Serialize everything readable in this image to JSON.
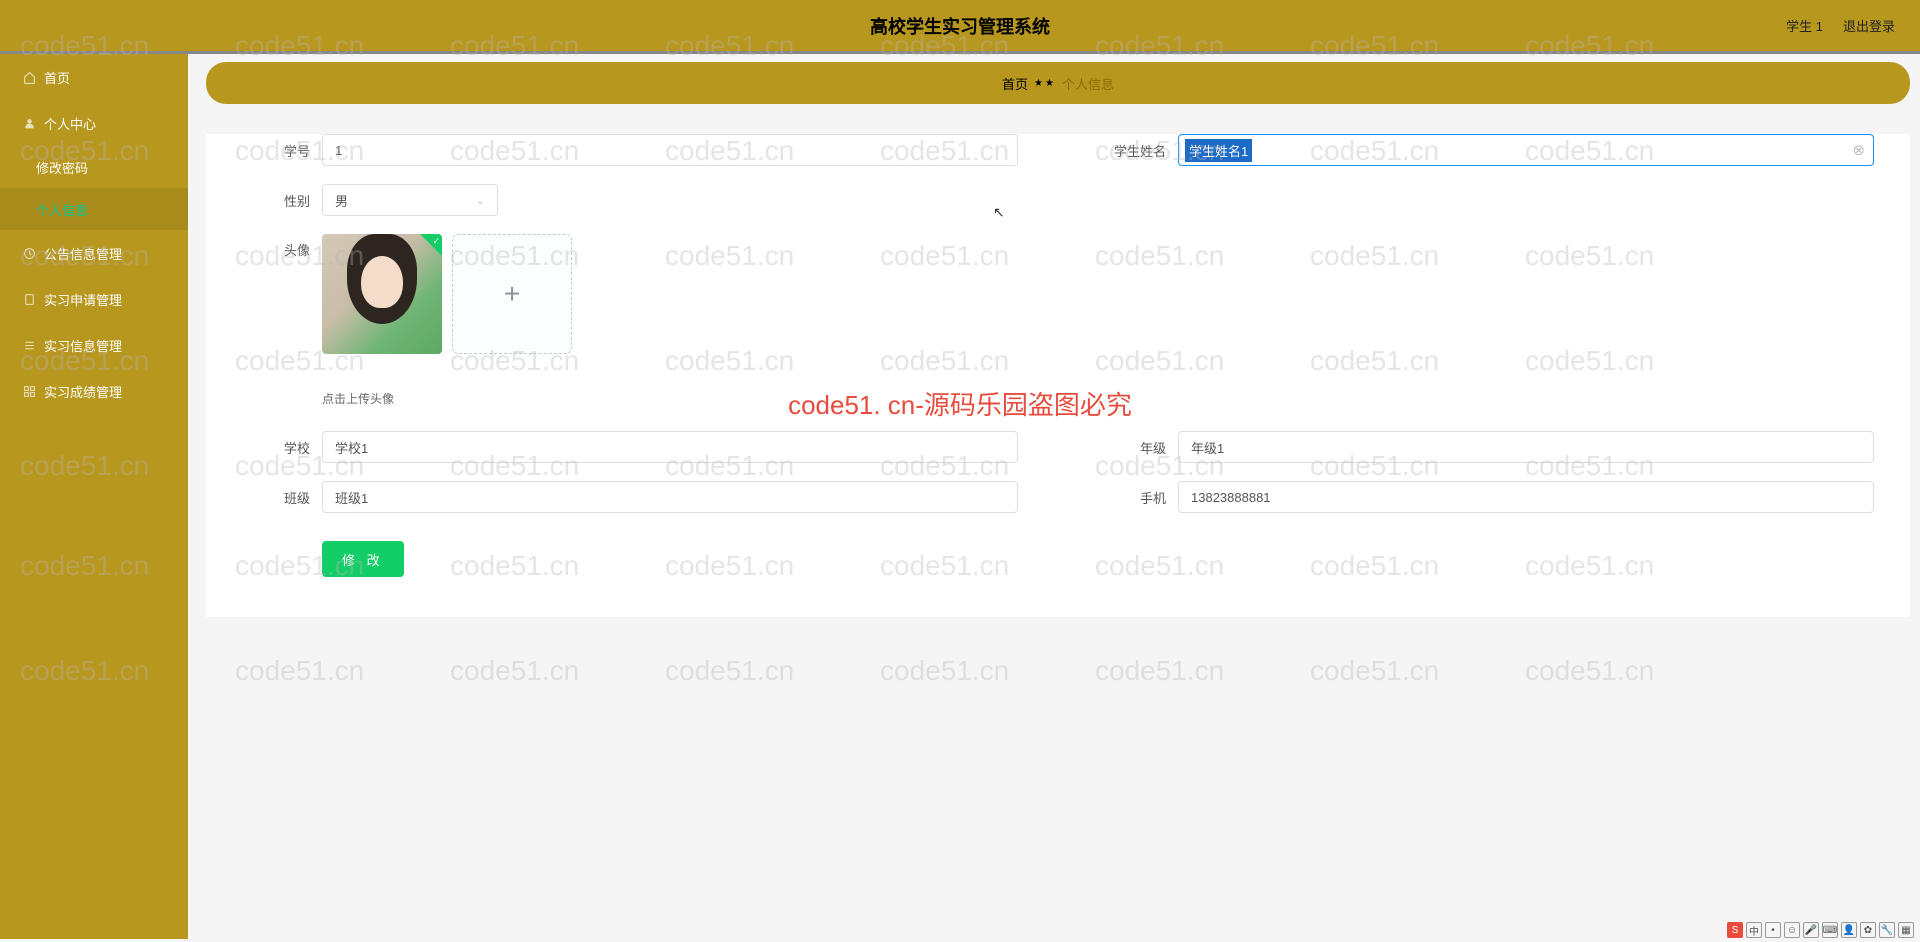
{
  "header": {
    "title": "高校学生实习管理系统",
    "user": "学生 1",
    "logout": "退出登录"
  },
  "sidebar": {
    "home": "首页",
    "personalCenter": "个人中心",
    "changePassword": "修改密码",
    "personalInfo": "个人信息",
    "announcement": "公告信息管理",
    "application": "实习申请管理",
    "internInfo": "实习信息管理",
    "gradeInfo": "实习成绩管理"
  },
  "breadcrumb": {
    "root": "首页",
    "current": "个人信息"
  },
  "form": {
    "studentIdLabel": "学号",
    "studentId": "1",
    "studentNameLabel": "学生姓名",
    "studentName": "学生姓名1",
    "genderLabel": "性别",
    "gender": "男",
    "avatarLabel": "头像",
    "uploadHint": "点击上传头像",
    "schoolLabel": "学校",
    "school": "学校1",
    "gradeLabel": "年级",
    "grade": "年级1",
    "classLabel": "班级",
    "class": "班级1",
    "phoneLabel": "手机",
    "phone": "13823888881",
    "submit": "修 改"
  },
  "watermark": {
    "text": "code51.cn",
    "center": "code51. cn-源码乐园盗图必究"
  }
}
